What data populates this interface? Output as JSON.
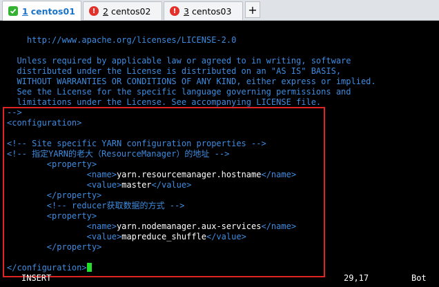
{
  "tabs": [
    {
      "number": "1",
      "name": "centos01",
      "status": "connected"
    },
    {
      "number": "2",
      "name": "centos02",
      "status": "disconnected"
    },
    {
      "number": "3",
      "name": "centos03",
      "status": "disconnected"
    }
  ],
  "add_tab_label": "+",
  "editor": {
    "lines": [
      {
        "text": "    http://www.apache.org/licenses/LICENSE-2.0",
        "kind": "comment"
      },
      {
        "text": "",
        "kind": "comment"
      },
      {
        "text": "  Unless required by applicable law or agreed to in writing, software",
        "kind": "comment"
      },
      {
        "text": "  distributed under the License is distributed on an \"AS IS\" BASIS,",
        "kind": "comment"
      },
      {
        "text": "  WITHOUT WARRANTIES OR CONDITIONS OF ANY KIND, either express or implied.",
        "kind": "comment"
      },
      {
        "text": "  See the License for the specific language governing permissions and",
        "kind": "comment"
      },
      {
        "text": "  limitations under the License. See accompanying LICENSE file.",
        "kind": "comment"
      },
      {
        "text": "-->",
        "kind": "comment"
      },
      {
        "text": "<configuration>",
        "kind": "tag"
      },
      {
        "text": "",
        "kind": "tag"
      },
      {
        "text": "<!-- Site specific YARN configuration properties -->",
        "kind": "comment"
      },
      {
        "text": "<!-- 指定YARN的老大（ResourceManager）的地址 -->",
        "kind": "comment"
      },
      {
        "text": "        <property>",
        "kind": "tag"
      },
      {
        "text": "                <name>yarn.resourcemanager.hostname</name>",
        "kind": "mixed",
        "open": "<name>",
        "value": "yarn.resourcemanager.hostname",
        "close": "</name>"
      },
      {
        "text": "                <value>master</value>",
        "kind": "mixed",
        "open": "<value>",
        "value": "master",
        "close": "</value>"
      },
      {
        "text": "        </property>",
        "kind": "tag"
      },
      {
        "text": "        <!-- reducer获取数据的方式 -->",
        "kind": "comment"
      },
      {
        "text": "        <property>",
        "kind": "tag"
      },
      {
        "text": "                <name>yarn.nodemanager.aux-services</name>",
        "kind": "mixed",
        "open": "<name>",
        "value": "yarn.nodemanager.aux-services",
        "close": "</name>"
      },
      {
        "text": "                <value>mapreduce_shuffle</value>",
        "kind": "mixed",
        "open": "<value>",
        "value": "mapreduce_shuffle",
        "close": "</value>"
      },
      {
        "text": "        </property>",
        "kind": "tag"
      },
      {
        "text": "",
        "kind": "tag"
      },
      {
        "text": "</configuration>",
        "kind": "tag"
      }
    ]
  },
  "status": {
    "mode": "INSERT",
    "position": "29,17",
    "scroll": "Bot"
  },
  "colors": {
    "comment": "#3e8ce0",
    "tag": "#3e8ce0",
    "text": "#ffffff",
    "cursor": "#22e02a",
    "highlight_border": "#e02424",
    "active_tab": "#1a73c8"
  },
  "icons": {
    "connected": "check-icon",
    "disconnected": "exclamation-icon"
  }
}
